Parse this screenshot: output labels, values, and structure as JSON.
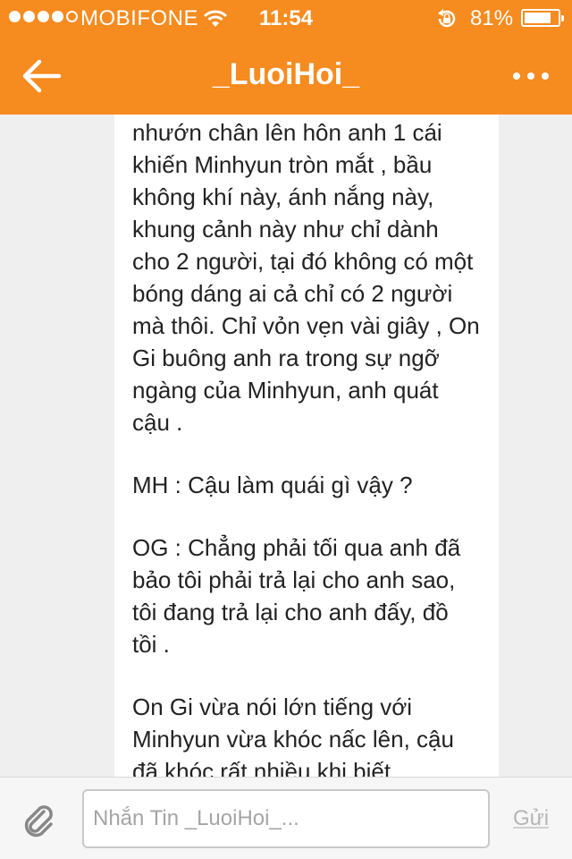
{
  "status_bar": {
    "signal_bars": 4,
    "signal_max": 5,
    "carrier": "MOBIFONE",
    "time": "11:54",
    "battery": "81%",
    "battery_level": 0.81,
    "icons": [
      "signal-dots-icon",
      "wifi-icon",
      "rotation-lock-icon",
      "battery-icon"
    ]
  },
  "header": {
    "title": "_LuoiHoi_",
    "background": "#f68b1f",
    "back_icon": "arrow-left-icon",
    "more_icon": "more-dots-icon"
  },
  "chat": {
    "paragraphs": [
      "nhướn chân lên hôn anh 1 cái\nkhiến Minhyun tròn mắt , bầu\nkhông khí này, ánh nắng này,\nkhung cảnh này như chỉ dành\ncho 2 người, tại đó không có một\nbóng dáng ai cả chỉ có 2 người\nmà thôi. Chỉ vỏn vẹn vài giây , On\nGi buông anh ra trong sự ngỡ\nngàng của Minhyun, anh quát\ncậu .",
      "MH : Cậu làm quái gì vậy ?",
      "OG : Chẳng phải tối qua anh đã\nbảo tôi phải trả lại cho anh sao,\ntôi đang trả lại cho anh đấy, đồ\ntồi .",
      "On Gi vừa nói lớn tiếng với\nMinhyun vừa khóc nấc lên, cậu\nđã khóc rất nhiều khi biết"
    ]
  },
  "composer": {
    "attach_icon": "paperclip-icon",
    "placeholder": "Nhắn Tin _LuoiHoi_...",
    "send_label": "Gửi"
  }
}
